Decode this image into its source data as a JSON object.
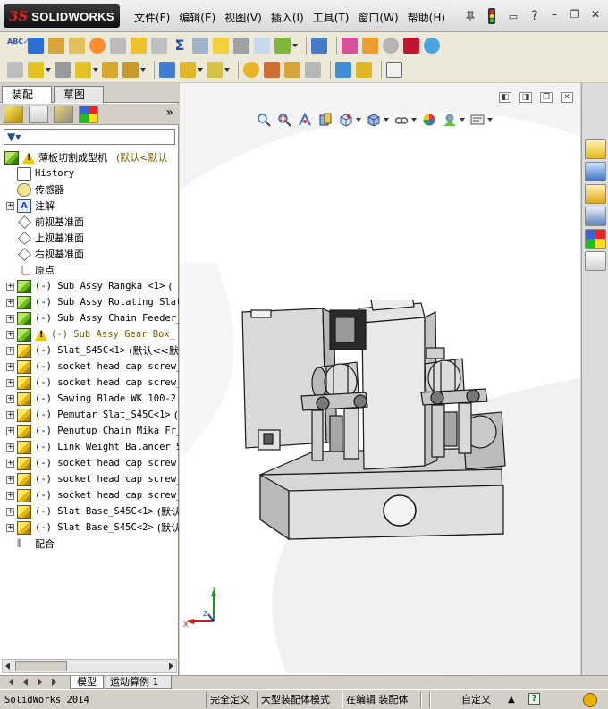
{
  "app": {
    "brand": "SOLIDWORKS",
    "brand_ds": "3S"
  },
  "menu": [
    "文件(F)",
    "编辑(E)",
    "视图(V)",
    "插入(I)",
    "工具(T)",
    "窗口(W)",
    "帮助(H)"
  ],
  "left_tabs": {
    "assembly": "装配体",
    "sketch": "草图"
  },
  "tree": {
    "root_label": "薄板切割成型机",
    "root_config": "(默认<默认",
    "items": [
      {
        "text": "History",
        "kind": "history"
      },
      {
        "text": "传感器",
        "kind": "sensor"
      },
      {
        "text": "注解",
        "kind": "annotation"
      },
      {
        "text": "前视基准面",
        "kind": "plane"
      },
      {
        "text": "上视基准面",
        "kind": "plane"
      },
      {
        "text": "右视基准面",
        "kind": "plane"
      },
      {
        "text": "原点",
        "kind": "origin"
      },
      {
        "text": "(-) Sub Assy Rangka_<1>",
        "kind": "asm",
        "suffix": "("
      },
      {
        "text": "(-) Sub Assy Rotating Slat",
        "kind": "asm"
      },
      {
        "text": "(-) Sub Assy Chain Feeder_",
        "kind": "asm"
      },
      {
        "text": "(-) Sub Assy Gear Box_",
        "kind": "asm-warn"
      },
      {
        "text": "(-) Slat_S45C<1>",
        "kind": "part",
        "suffix": "(默认<<默"
      },
      {
        "text": "(-) socket head cap screw_",
        "kind": "part"
      },
      {
        "text": "(-) socket head cap screw_",
        "kind": "part"
      },
      {
        "text": "(-) Sawing Blade WK 100-2",
        "kind": "part"
      },
      {
        "text": "(-) Pemutar Slat_S45C<1>",
        "kind": "part",
        "suffix": "("
      },
      {
        "text": "(-) Penutup Chain Mika Fr_",
        "kind": "part"
      },
      {
        "text": "(-) Link Weight Balancer_S",
        "kind": "part"
      },
      {
        "text": "(-) socket head cap screw_",
        "kind": "part"
      },
      {
        "text": "(-) socket head cap screw_",
        "kind": "part"
      },
      {
        "text": "(-) socket head cap screw_",
        "kind": "part"
      },
      {
        "text": "(-) Slat Base_S45C<1>",
        "kind": "part",
        "suffix": "(默认"
      },
      {
        "text": "(-) Slat Base_S45C<2>",
        "kind": "part",
        "suffix": "(默认"
      },
      {
        "text": "配合",
        "kind": "mates"
      }
    ]
  },
  "triad": {
    "x": "X",
    "y": "Y",
    "z": "Z"
  },
  "bottom_tabs": {
    "model": "模型",
    "motion": "运动算例 1"
  },
  "status": {
    "version": "SolidWorks 2014",
    "defined": "完全定义",
    "large_asm": "大型装配体模式",
    "editing": "在编辑 装配体",
    "custom": "自定义"
  },
  "colors": {
    "accent_red": "#d22222",
    "window_bg": "#d4d0c8",
    "tree_bg": "#ffffff"
  }
}
